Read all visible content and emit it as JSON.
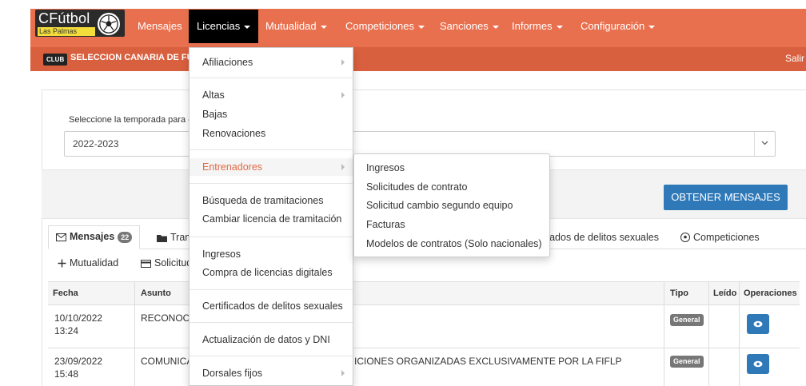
{
  "brand": {
    "name": "CFútbol",
    "sub": "Las Palmas"
  },
  "nav": [
    {
      "label": "Mensajes",
      "dropdown": false
    },
    {
      "label": "Licencias",
      "dropdown": true
    },
    {
      "label": "Mutualidad",
      "dropdown": true
    },
    {
      "label": "Competiciones",
      "dropdown": true
    },
    {
      "label": "Sanciones",
      "dropdown": true
    },
    {
      "label": "Informes",
      "dropdown": true
    },
    {
      "label": "Configuración",
      "dropdown": true
    }
  ],
  "subbar": {
    "badge": "CLUB",
    "club_name": "SELECCION CANARIA DE FUTBOL",
    "logout": "Salir"
  },
  "season": {
    "label": "Seleccione la temporada para consultar",
    "value": "2022-2023"
  },
  "actions": {
    "obtener": "OBTENER MENSAJES"
  },
  "tabs": {
    "mensajes": {
      "label": "Mensajes",
      "count": "22"
    },
    "tramitaciones": "Tramitaciones",
    "certificados": "Certificados de delitos sexuales",
    "competiciones": "Competiciones",
    "mutualidad": "Mutualidad",
    "solicitudes": "Solicitudes"
  },
  "table": {
    "headers": {
      "fecha": "Fecha",
      "asunto": "Asunto",
      "tipo": "Tipo",
      "leido": "Leído",
      "operaciones": "Operaciones"
    },
    "rows": [
      {
        "fecha_date": "10/10/2022",
        "fecha_time": "13:24",
        "asunto_start": "RECONOCIMIENTO",
        "asunto_end": "",
        "tipo": "General"
      },
      {
        "fecha_date": "23/09/2022",
        "fecha_time": "15:48",
        "asunto_start": "COMUNICADO COMPET",
        "asunto_end": "ICIONES ORGANIZADAS EXCLUSIVAMENTE POR LA FIFLP",
        "tipo": "General"
      }
    ]
  },
  "licencias_menu": {
    "afiliaciones": "Afiliaciones",
    "altas": "Altas",
    "bajas": "Bajas",
    "renovaciones": "Renovaciones",
    "entrenadores": "Entrenadores",
    "busqueda": "Búsqueda de tramitaciones",
    "cambiar": "Cambiar licencia de tramitación",
    "ingresos": "Ingresos",
    "compra": "Compra de licencias digitales",
    "certificados": "Certificados de delitos sexuales",
    "actualizacion": "Actualización de datos y DNI",
    "dorsales": "Dorsales fijos"
  },
  "entrenadores_menu": [
    "Ingresos",
    "Solicitudes de contrato",
    "Solicitud cambio segundo equipo",
    "Facturas",
    "Modelos de contratos (Solo nacionales)"
  ],
  "colors": {
    "header": "#e9704f",
    "subbar": "#d9603f",
    "accent": "#2f79b9",
    "menu_highlight": "#e06a44"
  }
}
